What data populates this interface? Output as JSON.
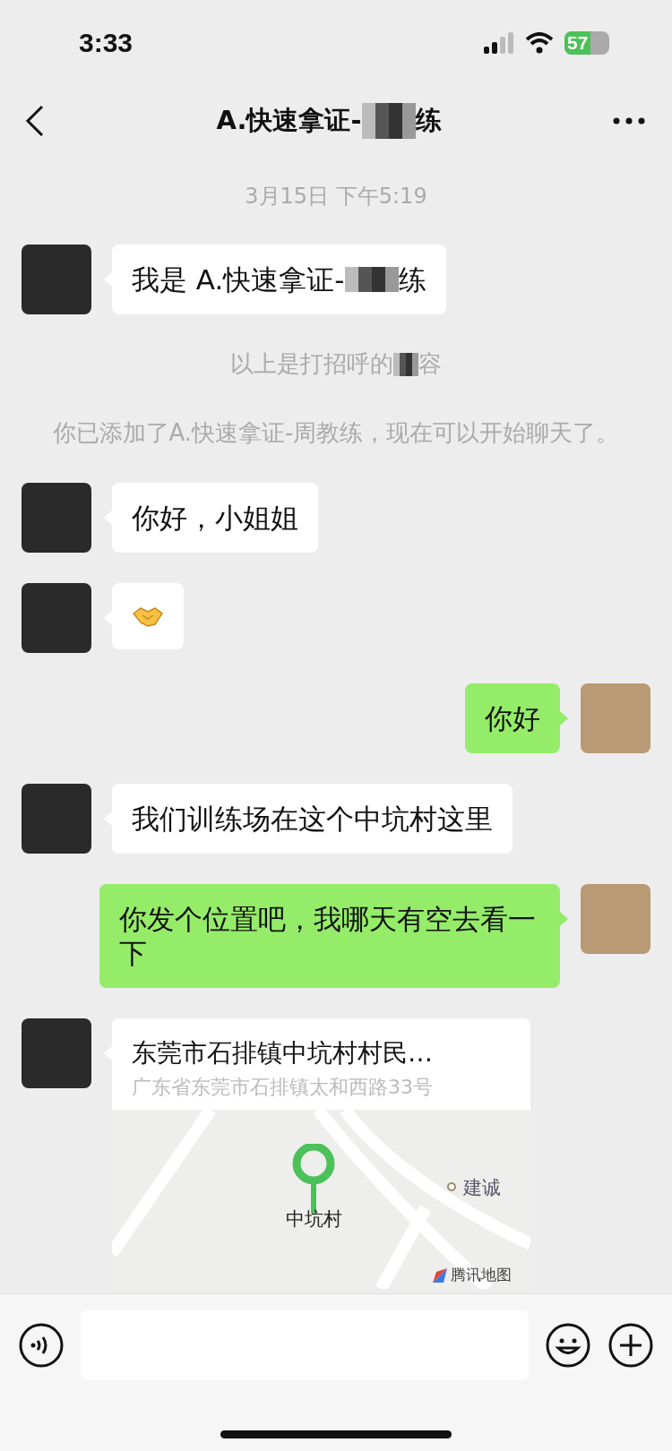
{
  "status_bar": {
    "time": "3:33",
    "battery": "57"
  },
  "nav": {
    "title_before": "A.快速拿证-",
    "title_after": "练"
  },
  "messages": [
    {
      "kind": "time",
      "text": "3月15日 下午5:19"
    },
    {
      "kind": "text",
      "outgoing": false,
      "before": "我是 A.快速拿证-",
      "after": "练"
    },
    {
      "kind": "system",
      "before": "以上是打招呼的",
      "after": "容"
    },
    {
      "kind": "system",
      "before": "你已添加了A.快速拿证-周教练，现在可以开始聊天了。"
    },
    {
      "kind": "text",
      "outgoing": false,
      "before": "你好，小姐姐"
    },
    {
      "kind": "emoji",
      "outgoing": false
    },
    {
      "kind": "text",
      "outgoing": true,
      "before": "你好"
    },
    {
      "kind": "text",
      "outgoing": false,
      "before": "我们训练场在这个中坑村这里"
    },
    {
      "kind": "text",
      "outgoing": true,
      "before": "你发个位置吧，我哪天有空去看一下"
    },
    {
      "kind": "location",
      "outgoing": false,
      "title": "东莞市石排镇中坑村村民…",
      "address": "广东省东莞市石排镇太和西路33号",
      "pin_label": "中坑村",
      "poi": "建诚",
      "provider": "腾讯地图"
    }
  ]
}
